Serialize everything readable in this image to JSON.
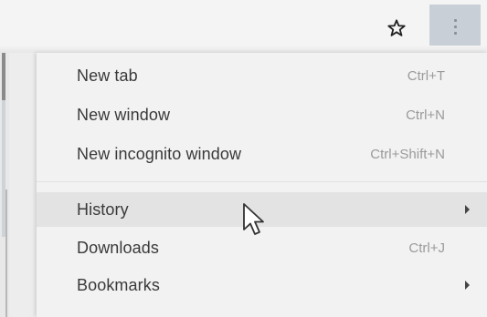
{
  "menu": {
    "items": [
      {
        "label": "New tab",
        "shortcut": "Ctrl+T",
        "submenu": false
      },
      {
        "label": "New window",
        "shortcut": "Ctrl+N",
        "submenu": false
      },
      {
        "label": "New incognito window",
        "shortcut": "Ctrl+Shift+N",
        "submenu": false
      },
      {
        "label": "History",
        "shortcut": "",
        "submenu": true
      },
      {
        "label": "Downloads",
        "shortcut": "Ctrl+J",
        "submenu": false
      },
      {
        "label": "Bookmarks",
        "shortcut": "",
        "submenu": true
      }
    ]
  },
  "icons": {
    "bookmark": "star-outline-icon",
    "menu": "vertical-dots-icon",
    "cursor": "mouse-pointer-icon"
  },
  "colors": {
    "menu_background": "#f2f2f2",
    "menu_button_background": "#c9cfd6",
    "label_text": "#3a3a3a",
    "shortcut_text": "#9a9a9a"
  }
}
